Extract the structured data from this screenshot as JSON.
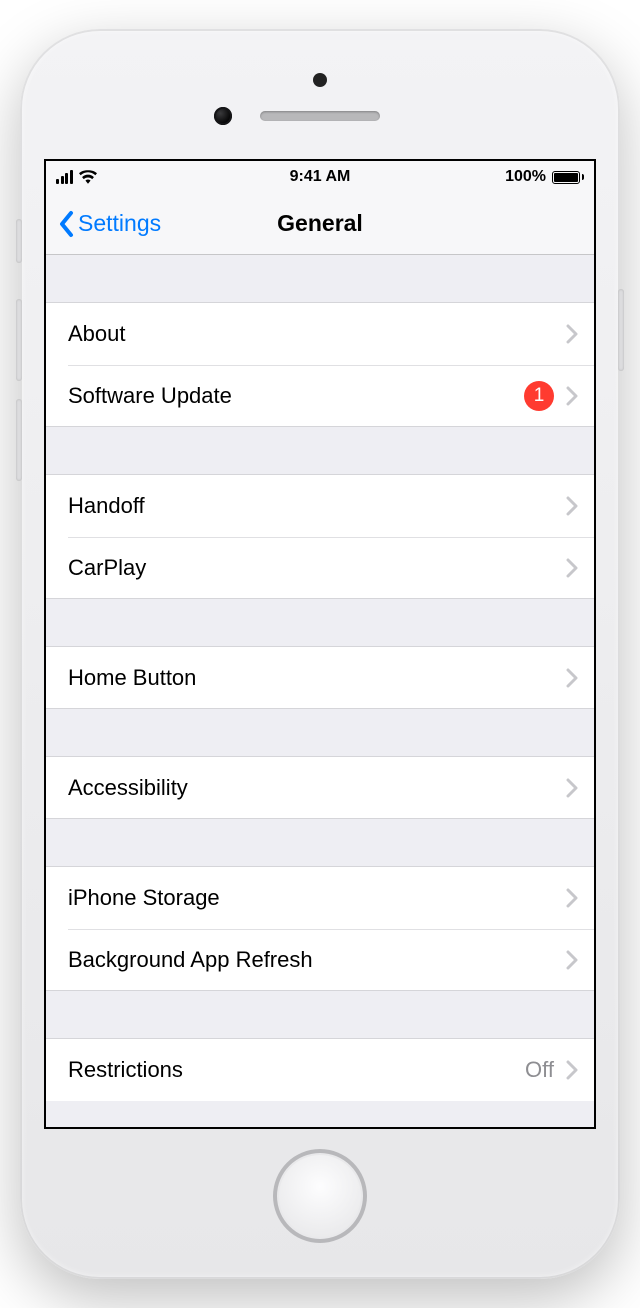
{
  "status": {
    "time": "9:41 AM",
    "battery_pct": "100%"
  },
  "nav": {
    "back_label": "Settings",
    "title": "General"
  },
  "sections": {
    "s0": {
      "about": {
        "label": "About"
      },
      "swupdate": {
        "label": "Software Update",
        "badge": "1"
      }
    },
    "s1": {
      "handoff": {
        "label": "Handoff"
      },
      "carplay": {
        "label": "CarPlay"
      }
    },
    "s2": {
      "homebtn": {
        "label": "Home Button"
      }
    },
    "s3": {
      "accessibility": {
        "label": "Accessibility"
      }
    },
    "s4": {
      "storage": {
        "label": "iPhone Storage"
      },
      "bgrefresh": {
        "label": "Background App Refresh"
      }
    },
    "s5": {
      "restrictions": {
        "label": "Restrictions",
        "detail": "Off"
      }
    }
  }
}
